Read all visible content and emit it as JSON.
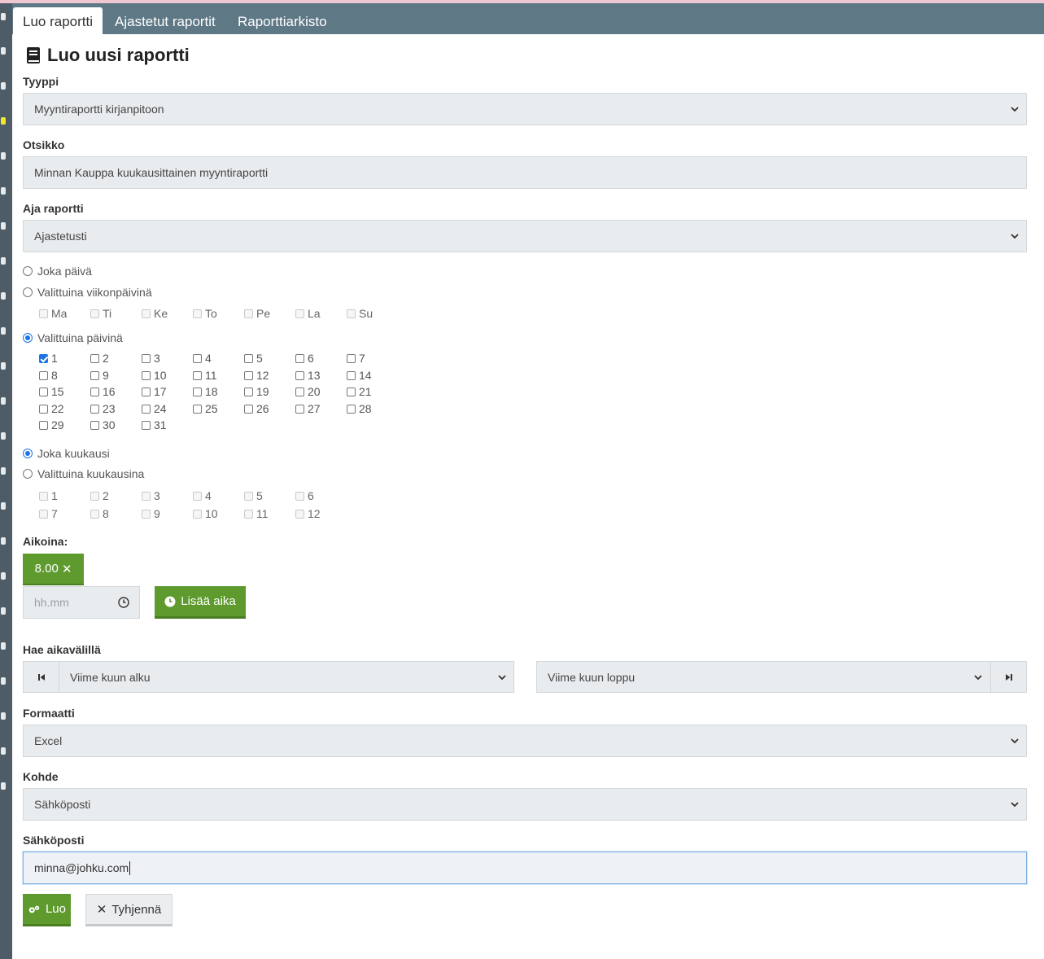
{
  "tabs": [
    {
      "label": "Luo raportti",
      "active": true
    },
    {
      "label": "Ajastetut raportit",
      "active": false
    },
    {
      "label": "Raporttiarkisto",
      "active": false
    }
  ],
  "page_title": "Luo uusi raportti",
  "type": {
    "label": "Tyyppi",
    "value": "Myyntiraportti kirjanpitoon"
  },
  "title_field": {
    "label": "Otsikko",
    "value": "Minnan Kauppa kuukausittainen myyntiraportti"
  },
  "run": {
    "label": "Aja raportti",
    "value": "Ajastetusti"
  },
  "schedule": {
    "every_day": "Joka päivä",
    "weekdays_option": "Valittuina viikonpäivinä",
    "weekdays": [
      "Ma",
      "Ti",
      "Ke",
      "To",
      "Pe",
      "La",
      "Su"
    ],
    "days_option": "Valittuina päivinä",
    "selected_days": [
      1
    ],
    "every_month": "Joka kuukausi",
    "months_option": "Valittuina kuukausina",
    "day_mode": "selected_days",
    "month_mode": "every_month"
  },
  "times": {
    "label": "Aikoina:",
    "chips": [
      "8.00"
    ],
    "placeholder": "hh.mm",
    "add_button": "Lisää aika"
  },
  "period": {
    "label": "Hae aikavälillä",
    "start": "Viime kuun alku",
    "end": "Viime kuun loppu"
  },
  "format": {
    "label": "Formaatti",
    "value": "Excel"
  },
  "target": {
    "label": "Kohde",
    "value": "Sähköposti"
  },
  "email": {
    "label": "Sähköposti",
    "value": "minna@johku.com"
  },
  "actions": {
    "create": "Luo",
    "clear": "Tyhjennä"
  },
  "colors": {
    "accent": "#5f9a2f",
    "tabbar": "#5e7886",
    "sidebar": "#4d5c66",
    "radio": "#1a73e8"
  }
}
